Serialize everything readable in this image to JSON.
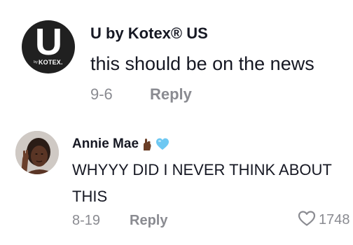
{
  "comments": [
    {
      "username": "U by Kotex® US",
      "avatar": {
        "letter": "U",
        "brand_by": "by",
        "brand_name": "KOTEX."
      },
      "text": "this should be on the news",
      "date": "9-6",
      "reply_label": "Reply"
    },
    {
      "username": "Annie Mae",
      "emojis": [
        "dark-hand-pinch-icon",
        "blue-heart-icon"
      ],
      "text": "WHYYY DID I NEVER THINK ABOUT THIS",
      "date": "8-19",
      "reply_label": "Reply",
      "like_count": "1748"
    }
  ],
  "colors": {
    "text_primary": "#161823",
    "text_secondary": "#8a8b91",
    "avatar_dark": "#202020",
    "heart_blue": "#6ec8f2",
    "hand_brown": "#6b3e26"
  }
}
